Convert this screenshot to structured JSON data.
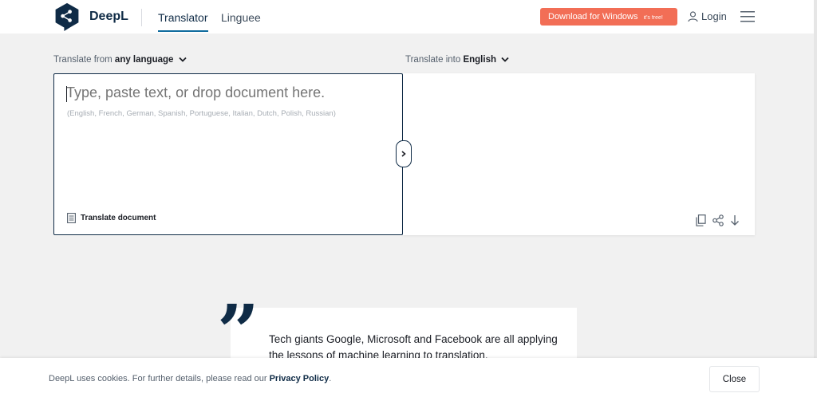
{
  "header": {
    "brand": "DeepL",
    "tabs": [
      {
        "label": "Translator",
        "active": true
      },
      {
        "label": "Linguee",
        "active": false
      }
    ],
    "download_label": "Download for Windows",
    "download_badge": "it's free!",
    "login_label": "Login",
    "accent_color": "#f26e56",
    "brand_color": "#0f2b46"
  },
  "lang_from": {
    "prefix": "Translate from",
    "value": "any language"
  },
  "lang_to": {
    "prefix": "Translate into",
    "value": "English"
  },
  "source": {
    "placeholder": "Type, paste text, or drop document here.",
    "value": "",
    "hint": "(English, French, German, Spanish, Portuguese, Italian, Dutch, Polish, Russian)",
    "translate_document_label": "Translate document"
  },
  "target": {
    "tools": [
      "copy-icon",
      "share-icon",
      "download-icon"
    ]
  },
  "quote": {
    "text": "Tech giants Google, Microsoft and Facebook are all applying the lessons of machine learning to translation,"
  },
  "cookie": {
    "text": "DeepL uses cookies. For further details, please read our",
    "link": "Privacy Policy",
    "trailing": ".",
    "close_label": "Close"
  }
}
